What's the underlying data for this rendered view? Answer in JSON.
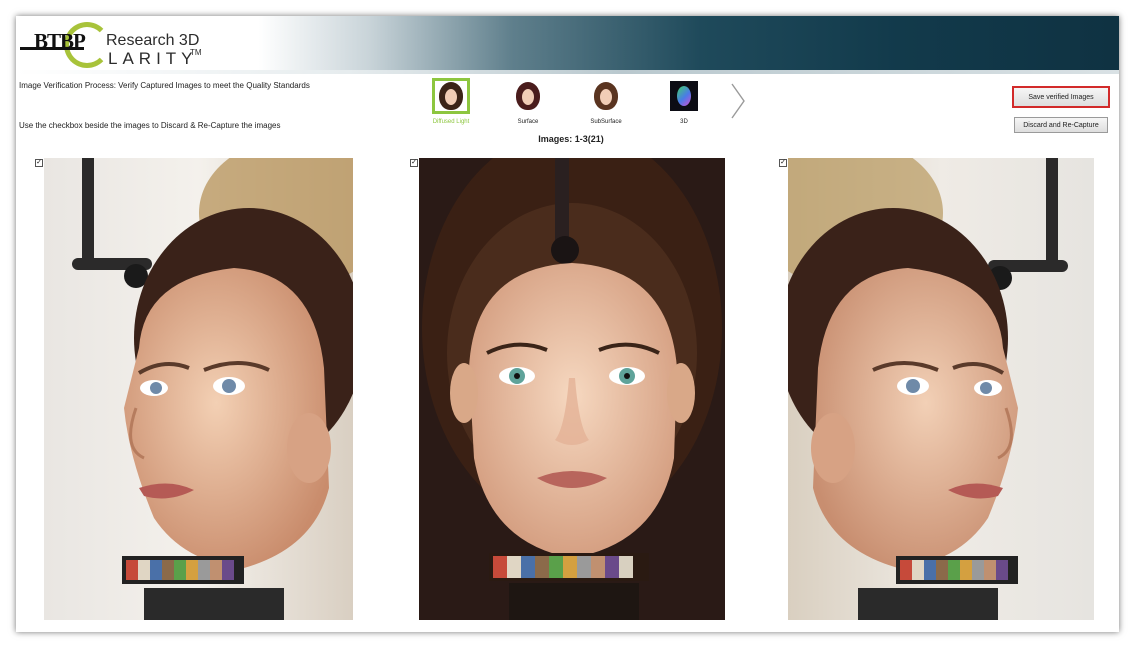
{
  "app": {
    "brand_btbp": "BTBP",
    "brand_research": "Research 3D",
    "brand_larity": "LARITY",
    "brand_tm": "TM"
  },
  "instructions": {
    "line1": "Image Verification Process: Verify Captured Images to meet the Quality Standards",
    "line2": "Use the checkbox beside the images to Discard & Re-Capture the images"
  },
  "modes": [
    {
      "label": "Diffused Light",
      "selected": true,
      "icon": "face-diffused-icon"
    },
    {
      "label": "Surface",
      "selected": false,
      "icon": "face-surface-icon"
    },
    {
      "label": "SubSurface",
      "selected": false,
      "icon": "face-subsurface-icon"
    },
    {
      "label": "3D",
      "selected": false,
      "icon": "face-3d-icon"
    }
  ],
  "counter": "Images: 1-3(21)",
  "buttons": {
    "save": "Save verified Images",
    "discard": "Discard and Re-Capture"
  },
  "images": [
    {
      "checked": true,
      "view": "left"
    },
    {
      "checked": true,
      "view": "front"
    },
    {
      "checked": true,
      "view": "right"
    }
  ],
  "colors": {
    "accent_green": "#8dc63f",
    "save_outline": "#d22a2a",
    "header_dark": "#0f3242"
  }
}
